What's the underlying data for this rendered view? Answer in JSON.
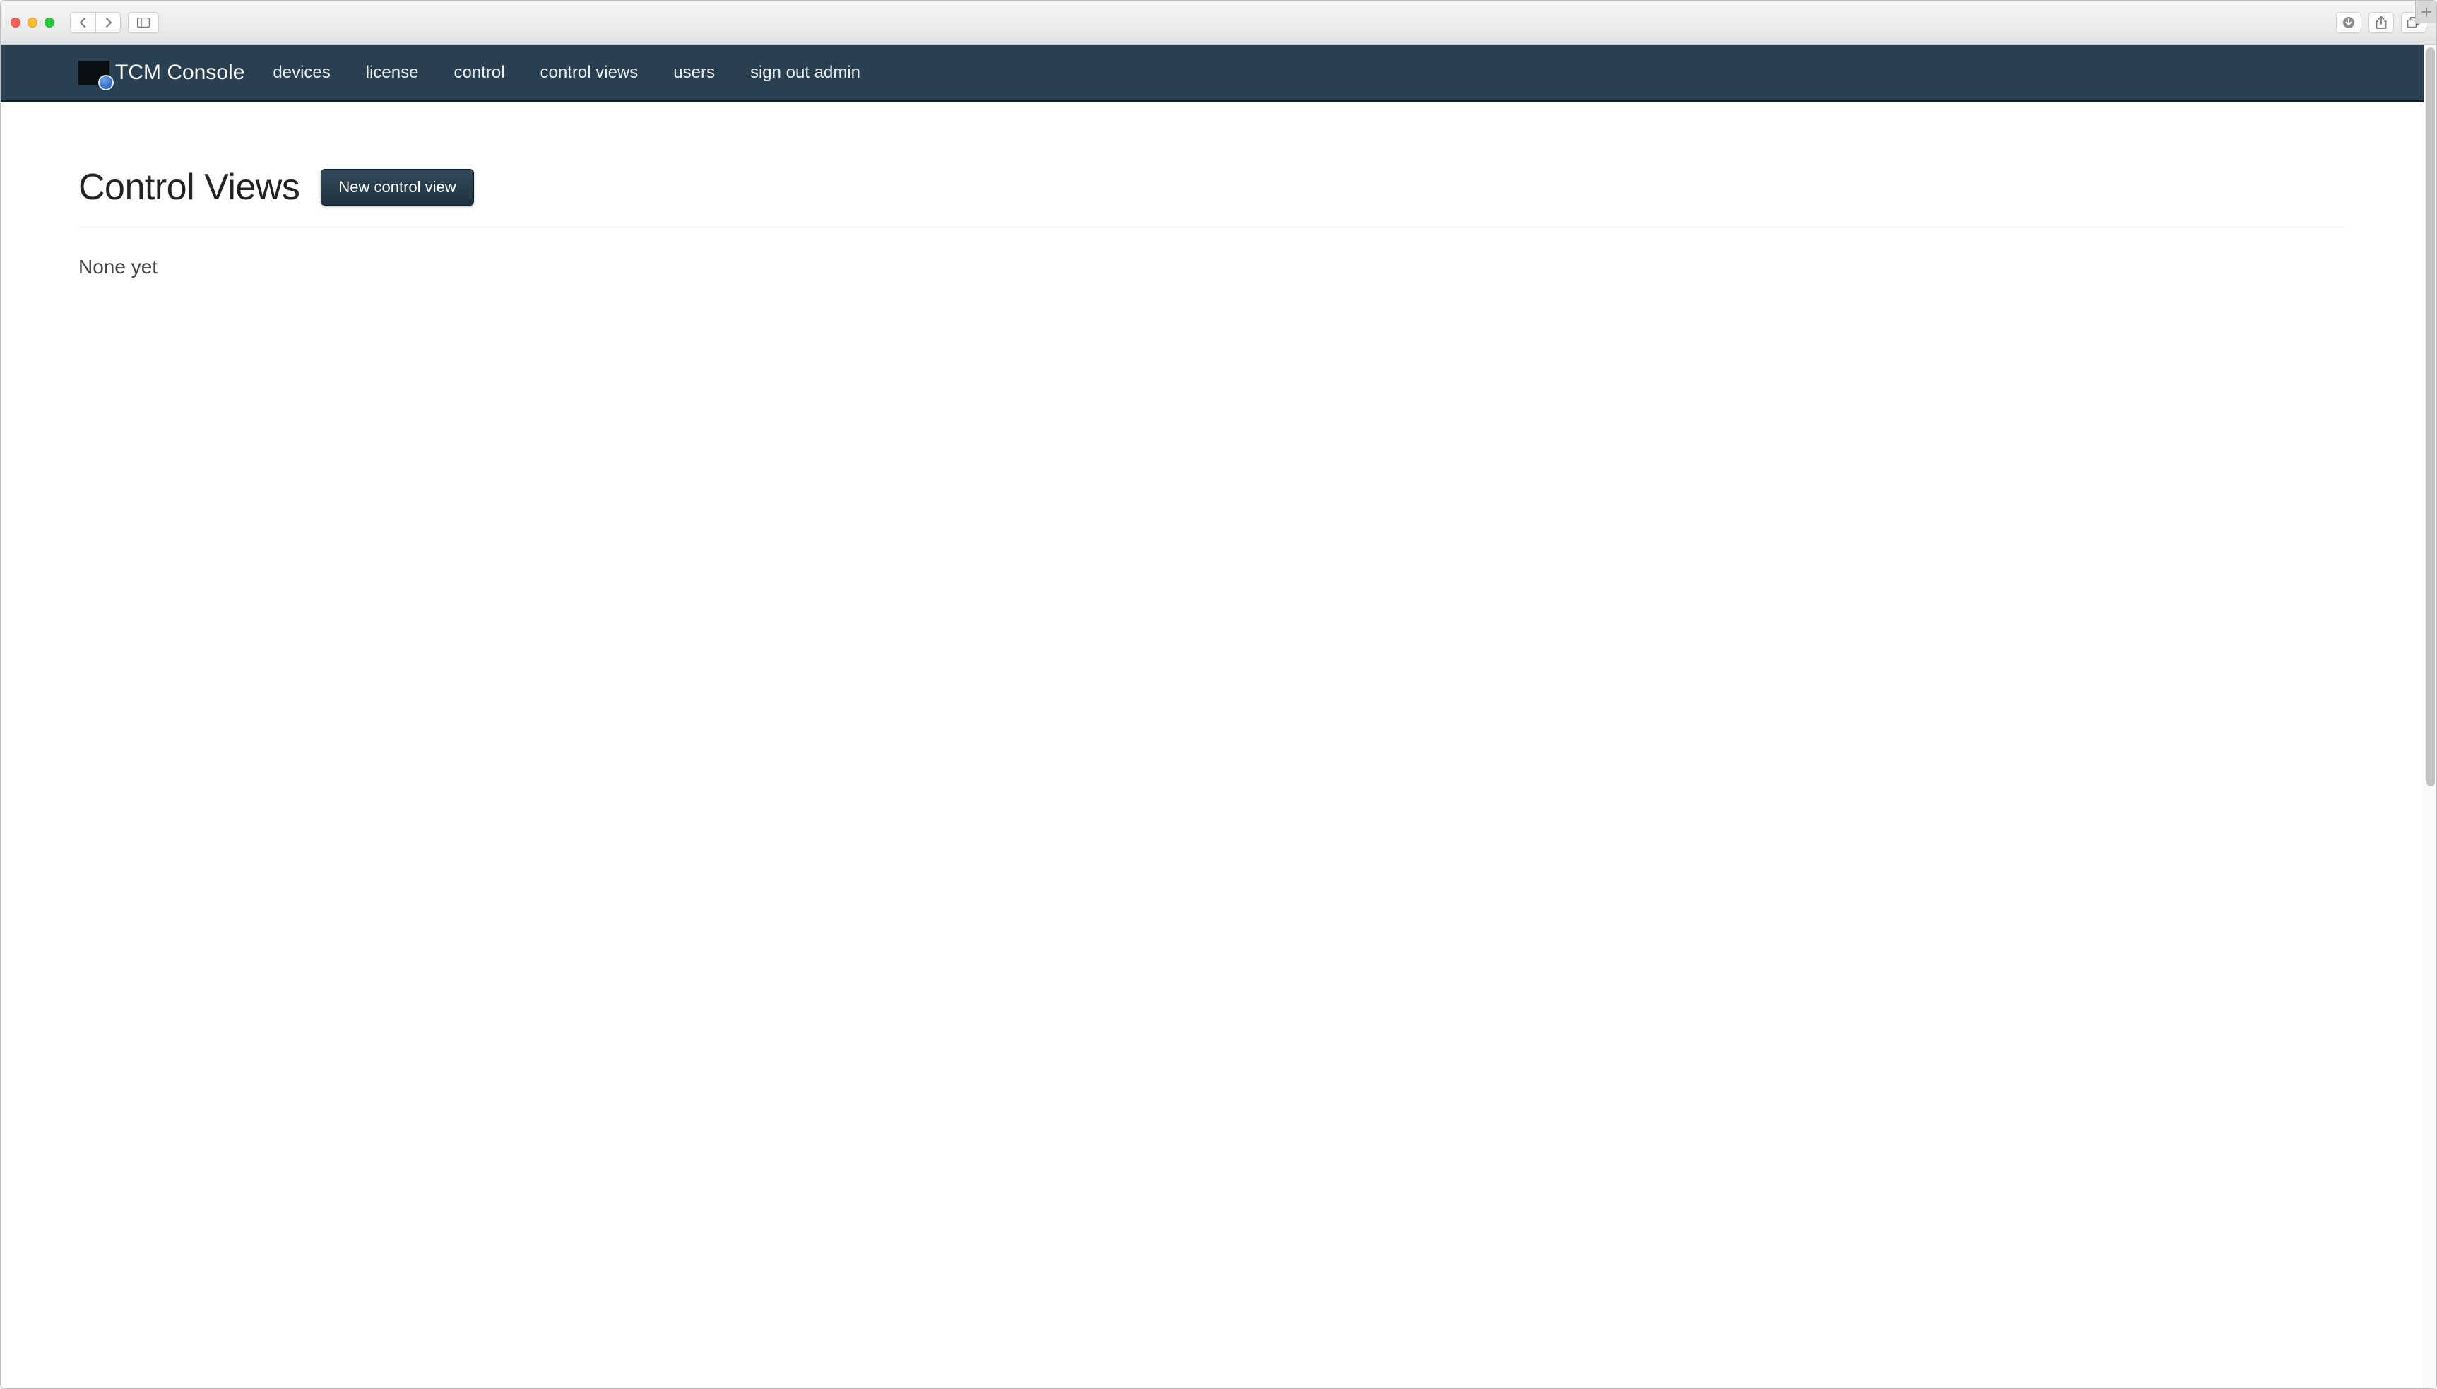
{
  "brand": {
    "title": "TCM Console"
  },
  "nav": {
    "items": [
      {
        "label": "devices"
      },
      {
        "label": "license"
      },
      {
        "label": "control"
      },
      {
        "label": "control views"
      },
      {
        "label": "users"
      },
      {
        "label": "sign out admin"
      }
    ]
  },
  "main": {
    "title": "Control Views",
    "new_button_label": "New control view",
    "empty_message": "None yet"
  }
}
